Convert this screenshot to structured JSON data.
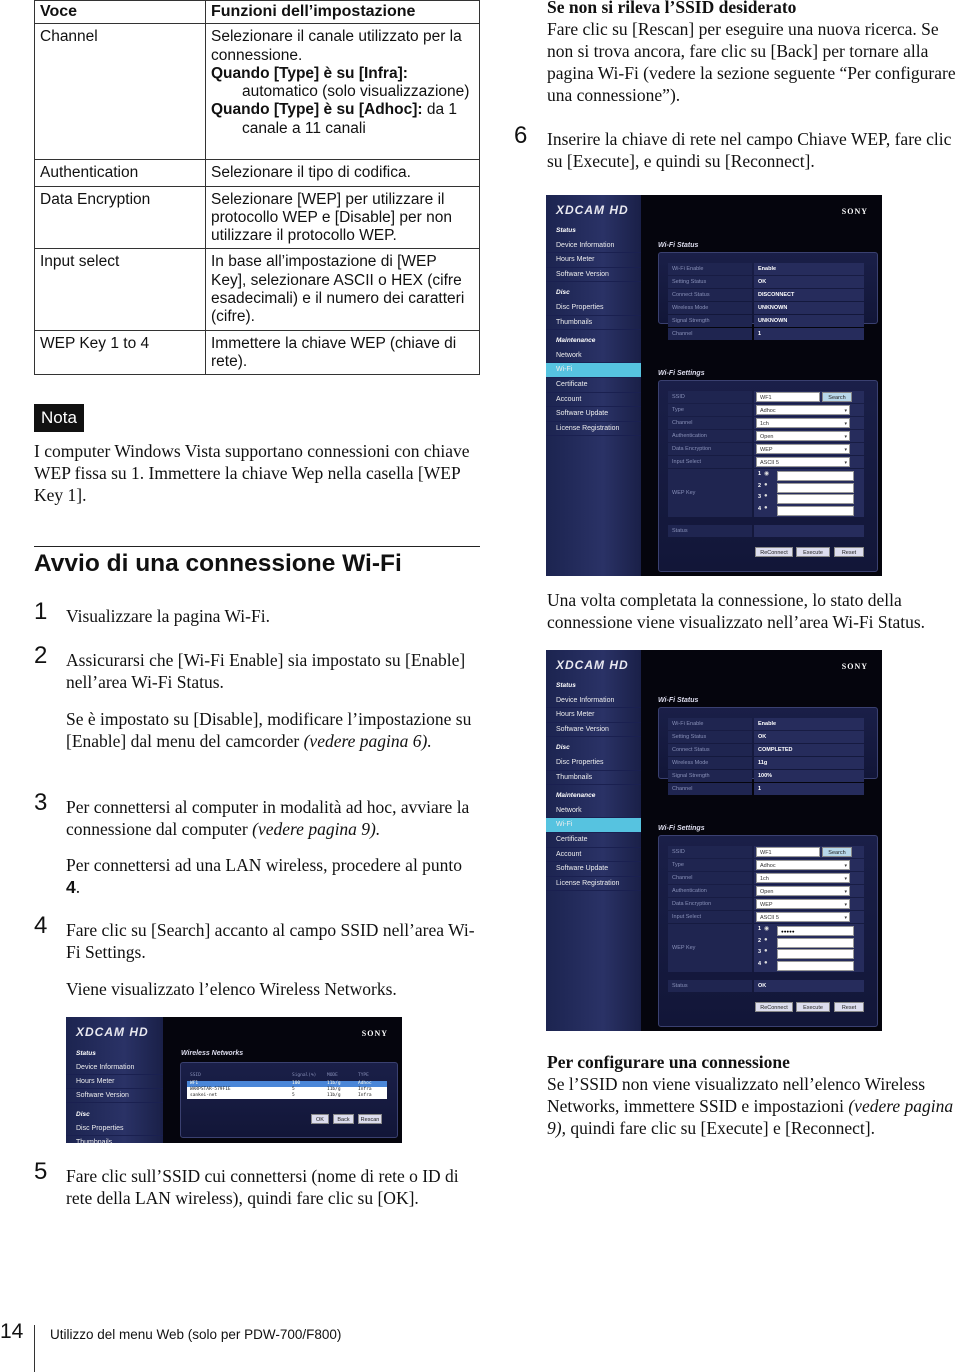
{
  "table": {
    "headers": [
      "Voce",
      "Funzioni dell’impostazione"
    ],
    "rows": [
      {
        "item": "Channel",
        "l1": "Selezionare il canale utilizzato per la connessione.",
        "b1": "Quando [Type] è su [Infra]:",
        "i1": "automatico (solo visualizzazione)",
        "b2": "Quando [Type] è su [Adhoc]:",
        "t2": " da 1",
        "i2": "canale a 11 canali"
      },
      {
        "item": "Authentication",
        "desc": "Selezionare il tipo di codifica."
      },
      {
        "item": "Data Encryption",
        "desc": "Selezionare [WEP] per utilizzare il protocollo WEP e [Disable] per non utilizzare il protocollo WEP."
      },
      {
        "item": "Input select",
        "desc": "In base all’impostazione di [WEP Key], selezionare ASCII o HEX (cifre esadecimali) e il numero dei caratteri (cifre)."
      },
      {
        "item": "WEP Key 1 to 4",
        "desc": "Immettere la chiave WEP (chiave di rete)."
      }
    ]
  },
  "note": {
    "badge": "Nota",
    "text": "I computer Windows Vista supportano connessioni con chiave WEP fissa su 1. Immettere la chiave Wep nella casella [WEP Key 1]."
  },
  "section": {
    "title": "Avvio di una connessione Wi-Fi",
    "steps": [
      {
        "n": "1",
        "text": "Visualizzare la pagina Wi-Fi."
      },
      {
        "n": "2",
        "text": "Assicurarsi che [Wi-Fi Enable] sia impostato su [Enable] nell’area Wi-Fi Status.",
        "sub": "Se è impostato su [Disable], modificare l’impostazione su [Enable] dal menu del camcorder ",
        "sub_ref": "(vedere pagina 6)."
      },
      {
        "n": "3",
        "text": "Per connettersi al computer in modalità ad hoc, avviare la connessione dal computer ",
        "ref": "(vedere pagina 9).",
        "sub": "Per connettersi ad una LAN wireless, procedere al punto ",
        "sub_bold": "4",
        "sub_end": "."
      },
      {
        "n": "4",
        "text": "Fare clic su [Search] accanto al campo SSID nell’area Wi-Fi Settings.",
        "sub": "Viene visualizzato l’elenco Wireless Networks."
      },
      {
        "n": "5",
        "text": "Fare clic sull’SSID cui connettersi (nome di rete o ID di rete della LAN wireless), quindi fare clic su [OK]."
      },
      {
        "n": "6",
        "text": "Inserire la chiave di rete nel campo Chiave WEP, fare clic su [Execute], e quindi su [Reconnect]."
      }
    ]
  },
  "right": {
    "not_found_title": "Se non si rileva l’SSID desiderato",
    "not_found_text": "Fare clic su [Rescan] per eseguire una nuova ricerca. Se non si trova ancora, fare clic su [Back] per tornare alla pagina Wi-Fi (vedere la sezione seguente “Per configurare una connessione”).",
    "completed_text": "Una volta completata la connessione, lo stato della connessione viene visualizzato nell’area Wi-Fi Status.",
    "config_title": "Per configurare una connessione",
    "config_text": "Se l’SSID non viene visualizzato nell’elenco Wireless Networks, immettere SSID e impostazioni ",
    "config_ref": "(vedere pagina 9)",
    "config_end": ", quindi fare clic su [Execute] e [Reconnect]."
  },
  "app": {
    "logo": "XDCAM HD",
    "brand": "SONY",
    "sidebar": [
      {
        "group": "Status",
        "items": [
          "Device Information",
          "Hours Meter",
          "Software Version"
        ]
      },
      {
        "group": "Disc",
        "items": [
          "Disc Properties",
          "Thumbnails"
        ]
      },
      {
        "group": "Maintenance",
        "items": [
          "Network",
          "Wi-Fi",
          "Certificate",
          "Account",
          "Software Update",
          "License Registration"
        ]
      }
    ],
    "selected": "Wi-Fi",
    "status_title": "Wi-Fi Status",
    "status_labels": [
      "Wi-Fi Enable",
      "Setting Status",
      "Connect Status",
      "Wireless Mode",
      "Signal Strength",
      "Channel"
    ],
    "settings_title": "Wi-Fi Settings",
    "settings_labels": [
      "SSID",
      "Type",
      "Channel",
      "Authentication",
      "Data Encryption",
      "Input Select",
      "WEP Key",
      "Status"
    ],
    "buttons": [
      "ReConnect",
      "Execute",
      "Reset"
    ],
    "search": "Search",
    "wep_indices": [
      "1",
      "2",
      "3",
      "4"
    ]
  },
  "screen_before": {
    "status_values": [
      "Enable",
      "OK",
      "DISCONNECT",
      "UNKNOWN",
      "UNKNOWN",
      "1"
    ],
    "ssid": "WF1",
    "type": "Adhoc",
    "channel": "1ch",
    "auth": "Open",
    "enc": "WEP",
    "input": "ASCII 5",
    "wep": [
      "",
      "",
      "",
      ""
    ],
    "wep_selected": 0,
    "status": ""
  },
  "screen_after": {
    "status_values": [
      "Enable",
      "OK",
      "COMPLETED",
      "11g",
      "100%",
      "1"
    ],
    "ssid": "WF1",
    "type": "Adhoc",
    "channel": "1ch",
    "auth": "Open",
    "enc": "WEP",
    "input": "ASCII 5",
    "wep": [
      "●●●●●",
      "",
      "",
      ""
    ],
    "wep_selected": 0,
    "status": "OK"
  },
  "networks": {
    "title": "Wireless Networks",
    "columns": [
      "SSID",
      "Signal(%)",
      "MODE",
      "TYPE"
    ],
    "rows": [
      [
        "WF1",
        "100",
        "11b/g",
        "Adhoc"
      ],
      [
        "WARPSTAR-579F1E",
        "5",
        "11b/g",
        "Infra"
      ],
      [
        "sankei-net",
        "5",
        "11b/g",
        "Infra"
      ]
    ],
    "selected_row": 0,
    "buttons": [
      "OK",
      "Back",
      "Rescan"
    ],
    "visible_sidebar": [
      {
        "group": "Status",
        "items": [
          "Device Information",
          "Hours Meter",
          "Software Version"
        ]
      },
      {
        "group": "Disc",
        "items": [
          "Disc Properties",
          "Thumbnails"
        ]
      }
    ]
  },
  "footer": {
    "page": "14",
    "text": "Utilizzo del menu Web (solo per PDW-700/F800)"
  }
}
